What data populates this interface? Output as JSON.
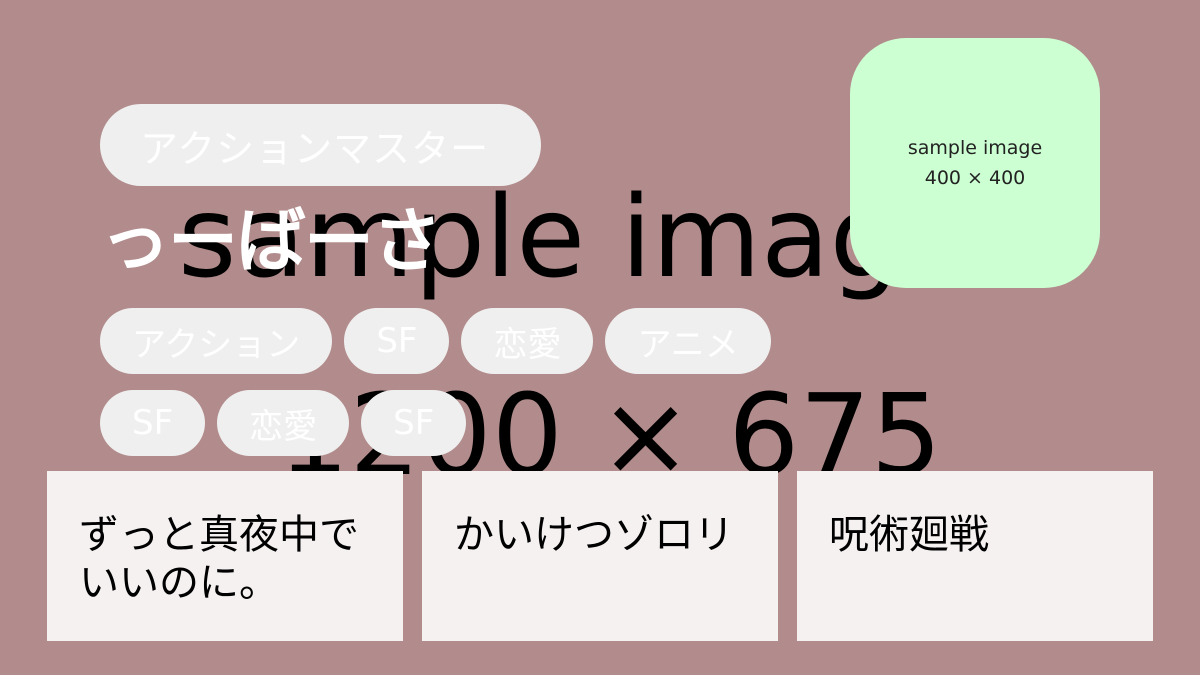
{
  "background": {
    "line1": "sample imag",
    "line2": "1200 × 675",
    "color": "#b28c8c"
  },
  "title_badge": {
    "label": "アクションマスター"
  },
  "username": "っーばーさ",
  "tags_row1": [
    "アクション",
    "SF",
    "恋愛",
    "アニメ"
  ],
  "tags_row2": [
    "SF",
    "恋愛",
    "SF"
  ],
  "avatar": {
    "line1": "sample image",
    "line2": "400 × 400",
    "color": "#ccffd2"
  },
  "cards": [
    {
      "title": "ずっと真夜中でいいのに。"
    },
    {
      "title": "かいけつゾロリ"
    },
    {
      "title": "呪術廻戦"
    }
  ]
}
